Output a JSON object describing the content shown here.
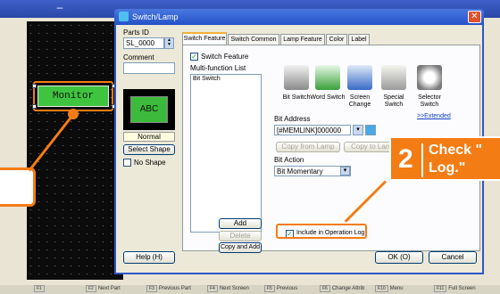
{
  "colors": {
    "accent": "#f47c14",
    "titlebar": "#2452c8",
    "canvas": "#0b0b0b",
    "button_green": "#3cba3c"
  },
  "canvas": {
    "monitor_label": "Monitor"
  },
  "dialog": {
    "title": "Switch/Lamp",
    "close_icon": "close-icon",
    "parts_id_label": "Parts ID",
    "parts_id_value": "SL_0000",
    "comment_label": "Comment",
    "comment_value": "",
    "preview_label": "ABC",
    "state_label": "Normal",
    "select_shape_label": "Select Shape",
    "no_shape_label": "No Shape",
    "no_shape_checked": false,
    "help_label": "Help (H)",
    "ok_label": "OK (O)",
    "cancel_label": "Cancel"
  },
  "tabs": [
    "Switch Feature",
    "Switch Common",
    "Lamp Feature",
    "Color",
    "Label"
  ],
  "active_tab": "Switch Feature",
  "switch_panel": {
    "switch_feature_label": "Switch Feature",
    "switch_feature_checked": true,
    "multi_function_label": "Multi-function List",
    "list_items": [
      "Bit Switch"
    ],
    "features": [
      {
        "label": "Bit Switch",
        "icon": "bit-switch-icon"
      },
      {
        "label": "Word Switch",
        "icon": "word-switch-icon"
      },
      {
        "label": "Screen Change",
        "icon": "screen-change-icon"
      },
      {
        "label": "Special Switch",
        "icon": "special-switch-icon"
      },
      {
        "label": "Selector Switch",
        "icon": "selector-switch-icon"
      }
    ],
    "extended_link": ">>Extended",
    "bit_address_label": "Bit Address",
    "bit_address_value": "[#MEMLINK]000000",
    "copy_from_lamp": "Copy from Lamp",
    "copy_to_lamp": "Copy to Lamp",
    "bit_action_label": "Bit Action",
    "bit_action_value": "Bit Momentary",
    "add_label": "Add",
    "delete_label": "Delete",
    "copy_add_label": "Copy and Add",
    "include_log_label": "Include in Operation Log",
    "include_log_checked": true
  },
  "callout": {
    "number": "2",
    "line1": "Check \"",
    "line2": "Log.\""
  },
  "statusbar": {
    "keys": [
      {
        "key": "F1",
        "label": ""
      },
      {
        "key": "F2",
        "label": "Next Part"
      },
      {
        "key": "F3",
        "label": "Previous Part"
      },
      {
        "key": "F4",
        "label": "Next Screen"
      },
      {
        "key": "F5",
        "label": "Previous"
      },
      {
        "key": "F6",
        "label": "Change Attrib"
      },
      {
        "key": "F10",
        "label": "Menu"
      },
      {
        "key": "F11",
        "label": "Full Screen"
      }
    ]
  }
}
